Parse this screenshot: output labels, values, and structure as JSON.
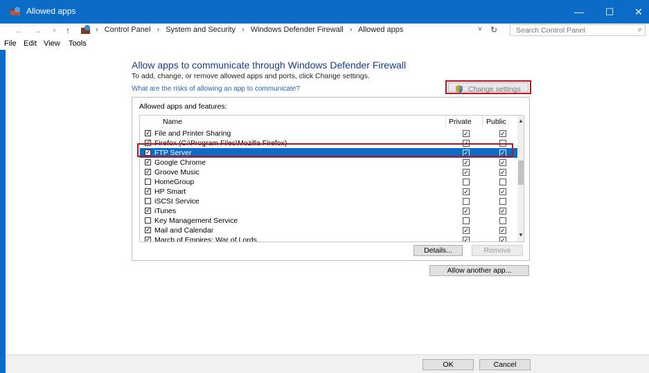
{
  "window": {
    "title": "Allowed apps",
    "minimize_glyph": "—",
    "maximize_glyph": "☐",
    "close_glyph": "✕"
  },
  "address": {
    "back": "←",
    "forward": "→",
    "recent": "˅",
    "up": "↑",
    "breadcrumbs": [
      "Control Panel",
      "System and Security",
      "Windows Defender Firewall",
      "Allowed apps"
    ],
    "separator": "›",
    "dropdown": "˅",
    "refresh": "↻",
    "search_placeholder": "Search Control Panel",
    "search_icon": "⌕"
  },
  "menu": {
    "file": "File",
    "edit": "Edit",
    "view": "View",
    "tools": "Tools"
  },
  "content": {
    "title": "Allow apps to communicate through Windows Defender Firewall",
    "subtitle": "To add, change, or remove allowed apps and ports, click Change settings.",
    "risk_link": "What are the risks of allowing an app to communicate?",
    "change_settings": "Change settings"
  },
  "panel": {
    "title": "Allowed apps and features:",
    "columns": {
      "name": "Name",
      "private": "Private",
      "public": "Public"
    },
    "rows": [
      {
        "name": "File and Printer Sharing",
        "enabled": true,
        "private": true,
        "public": true
      },
      {
        "name": "Firefox (C:\\Program Files\\Mozilla Firefox)",
        "enabled": true,
        "private": true,
        "public": false
      },
      {
        "name": "FTP Server",
        "enabled": true,
        "private": true,
        "public": true,
        "selected": true
      },
      {
        "name": "Google Chrome",
        "enabled": true,
        "private": true,
        "public": true
      },
      {
        "name": "Groove Music",
        "enabled": true,
        "private": true,
        "public": true
      },
      {
        "name": "HomeGroup",
        "enabled": false,
        "private": false,
        "public": false
      },
      {
        "name": "HP Smart",
        "enabled": true,
        "private": true,
        "public": true
      },
      {
        "name": "iSCSI Service",
        "enabled": false,
        "private": false,
        "public": false
      },
      {
        "name": "iTunes",
        "enabled": true,
        "private": true,
        "public": true
      },
      {
        "name": "Key Management Service",
        "enabled": false,
        "private": false,
        "public": false
      },
      {
        "name": "Mail and Calendar",
        "enabled": true,
        "private": true,
        "public": true
      },
      {
        "name": "March of Empires: War of Lords",
        "enabled": true,
        "private": true,
        "public": true
      }
    ],
    "details_button": "Details...",
    "remove_button": "Remove"
  },
  "allow_another_button": "Allow another app...",
  "footer": {
    "ok": "OK",
    "cancel": "Cancel"
  },
  "colors": {
    "titlebar": "#0b6cc7",
    "heading": "#1a3c8b",
    "link": "#2366b3",
    "highlight_outline": "#c0141c",
    "selection": "#0b6cc7"
  }
}
